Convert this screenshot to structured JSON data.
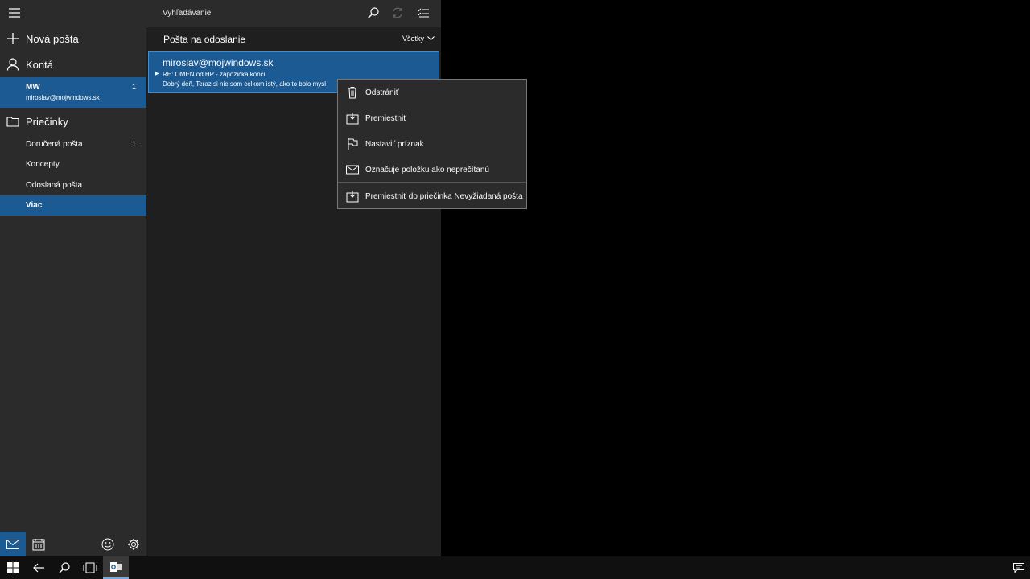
{
  "sidebar": {
    "new_mail": "Nová pošta",
    "accounts": "Kontá",
    "account": {
      "name": "MW",
      "email": "miroslav@mojwindows.sk",
      "count": "1"
    },
    "folders_label": "Priečinky",
    "folders": [
      {
        "label": "Doručená pošta",
        "count": "1"
      },
      {
        "label": "Koncepty",
        "count": ""
      },
      {
        "label": "Odoslaná pošta",
        "count": ""
      },
      {
        "label": "Viac",
        "count": ""
      }
    ],
    "bottom_icons": [
      "mail-icon",
      "calendar-icon",
      "feedback-smiley-icon",
      "settings-gear-icon"
    ]
  },
  "pane": {
    "search_placeholder": "Vyhľadávanie",
    "folder_title": "Pošta na odoslanie",
    "filter": "Všetky",
    "message": {
      "from": "miroslav@mojwindows.sk",
      "subject": "RE: OMEN od HP - zápožička konci",
      "preview": "Dobrý deň, Teraz si nie som celkom istý, ako to bolo mysl"
    }
  },
  "context_menu": {
    "items": [
      {
        "label": "Odstrániť",
        "icon": "trash-icon"
      },
      {
        "label": "Premiestniť",
        "icon": "move-icon"
      },
      {
        "label": "Nastaviť príznak",
        "icon": "flag-icon"
      },
      {
        "label": "Označuje položku ako neprečítanú",
        "icon": "envelope-icon"
      },
      {
        "label": "Premiestniť do priečinka Nevyžiadaná pošta",
        "icon": "junk-move-icon"
      }
    ]
  },
  "colors": {
    "accent": "#1c5a94",
    "sidebar_bg": "#2b2b2b",
    "pane_bg": "#1f1f1f"
  }
}
